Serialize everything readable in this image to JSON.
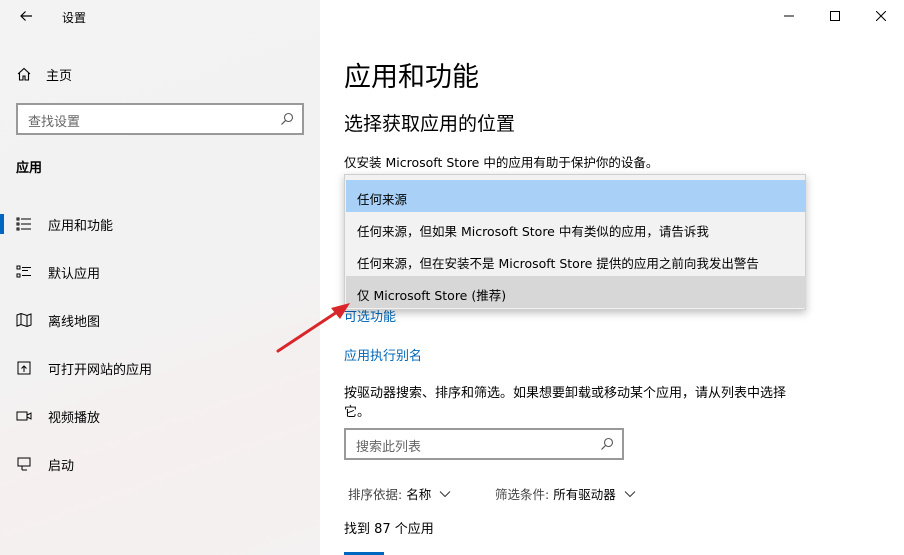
{
  "window": {
    "title": "设置",
    "controls": [
      "minimize-icon",
      "maximize-icon",
      "close-icon"
    ]
  },
  "sidebar": {
    "home_label": "主页",
    "search_placeholder": "查找设置",
    "section": "应用",
    "items": [
      {
        "label": "应用和功能",
        "icon": "apps-list-icon",
        "active": true
      },
      {
        "label": "默认应用",
        "icon": "default-apps-icon",
        "active": false
      },
      {
        "label": "离线地图",
        "icon": "map-icon",
        "active": false
      },
      {
        "label": "可打开网站的应用",
        "icon": "open-web-icon",
        "active": false
      },
      {
        "label": "视频播放",
        "icon": "video-icon",
        "active": false
      },
      {
        "label": "启动",
        "icon": "startup-icon",
        "active": false
      }
    ]
  },
  "main": {
    "title": "应用和功能",
    "subtitle": "选择获取应用的位置",
    "hint": "仅安装 Microsoft Store 中的应用有助于保护你的设备。",
    "dropdown_options": [
      "任何来源",
      "任何来源，但如果 Microsoft Store 中有类似的应用，请告诉我",
      "任何来源，但在安装不是 Microsoft Store 提供的应用之前向我发出警告",
      "仅 Microsoft Store (推荐)"
    ],
    "link_optional": "可选功能",
    "link_alias": "应用执行别名",
    "description": "按驱动器搜索、排序和筛选。如果想要卸载或移动某个应用，请从列表中选择它。",
    "list_search_placeholder": "搜索此列表",
    "sort_key": "排序依据:",
    "sort_value": "名称",
    "filter_key": "筛选条件:",
    "filter_value": "所有驱动器",
    "found_count": "找到 87 个应用"
  },
  "colors": {
    "accent": "#0067c0",
    "link": "#0067b8",
    "selected_option": "#a9d1f7",
    "annotation_arrow": "#d9262b"
  }
}
